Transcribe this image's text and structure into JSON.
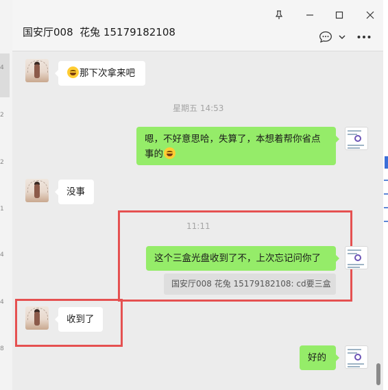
{
  "window": {
    "title": "国安厅008  花兔 15179182108",
    "controls": {
      "pin_icon": "pin-icon",
      "minimize_icon": "minimize-icon",
      "maximize_icon": "maximize-icon",
      "close_icon": "close-icon"
    },
    "header_actions": {
      "chat_icon": "chat-bubble-icon",
      "dropdown_icon": "chevron-down-icon",
      "more_icon": "more-icon"
    }
  },
  "left_strip": {
    "numbers": [
      "4",
      "2",
      "2",
      "1",
      "4",
      "4",
      "8"
    ]
  },
  "messages": [
    {
      "side": "left",
      "text": "那下次拿来吧",
      "emoji": "grin-emoji"
    },
    {
      "type": "time",
      "text": "星期五 14:53"
    },
    {
      "side": "right",
      "text_line1": "嗯，不好意思哈，失算了，本想着帮你省点",
      "text_line2": "事的",
      "emoji": "laugh-cry-emoji"
    },
    {
      "side": "left",
      "text": "没事"
    },
    {
      "type": "time",
      "text": "11:11"
    },
    {
      "side": "right",
      "text": "这个三盒光盘收到了不，上次忘记问你了"
    },
    {
      "type": "quote",
      "text": "国安厅008  花兔 15179182108: cd要三盒"
    },
    {
      "side": "left",
      "text": "收到了"
    },
    {
      "side": "right",
      "text": "好的"
    }
  ],
  "colors": {
    "sent_bubble": "#95ec69",
    "received_bubble": "#ffffff",
    "chat_background": "#ececec",
    "highlight_box": "#e55050"
  }
}
